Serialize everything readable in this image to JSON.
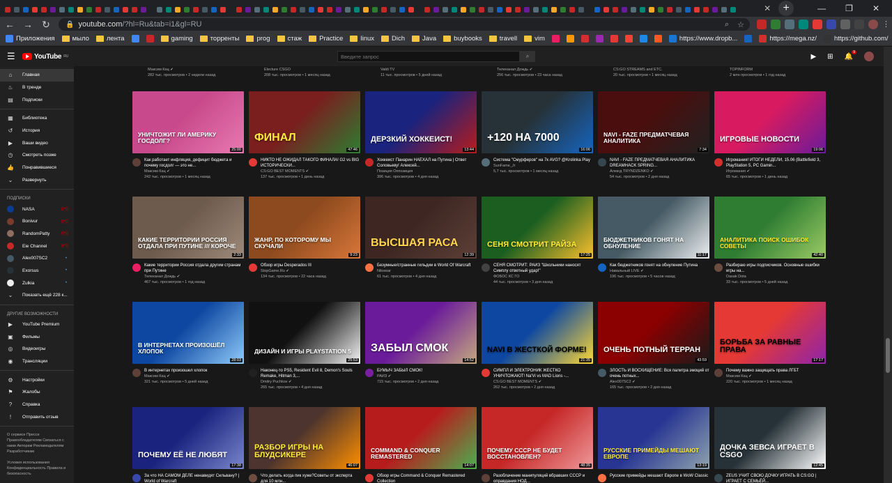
{
  "browser": {
    "url_host": "youtube.com",
    "url_path": "/?hl=Ru&tab=i1&gl=RU",
    "bookmarks": [
      {
        "label": "Приложения",
        "kind": "apps"
      },
      {
        "label": "мыло",
        "kind": "folder"
      },
      {
        "label": "лента",
        "kind": "folder"
      },
      {
        "label": "",
        "kind": "icon",
        "color": "#4285f4"
      },
      {
        "label": "",
        "kind": "icon",
        "color": "#c62828"
      },
      {
        "label": "gaming",
        "kind": "folder"
      },
      {
        "label": "торренты",
        "kind": "folder"
      },
      {
        "label": "prog",
        "kind": "folder"
      },
      {
        "label": "стаж",
        "kind": "folder"
      },
      {
        "label": "Practice",
        "kind": "folder"
      },
      {
        "label": "linux",
        "kind": "folder"
      },
      {
        "label": "Dich",
        "kind": "folder"
      },
      {
        "label": "Java",
        "kind": "folder"
      },
      {
        "label": "buybooks",
        "kind": "folder"
      },
      {
        "label": "travell",
        "kind": "folder"
      },
      {
        "label": "vim",
        "kind": "folder"
      },
      {
        "label": "",
        "kind": "icon",
        "color": "#e91e63"
      },
      {
        "label": "",
        "kind": "icon",
        "color": "#ff9800"
      },
      {
        "label": "",
        "kind": "icon",
        "color": "#d32f2f"
      },
      {
        "label": "",
        "kind": "icon",
        "color": "#9c27b0"
      },
      {
        "label": "",
        "kind": "icon",
        "color": "#e53935"
      },
      {
        "label": "",
        "kind": "icon",
        "color": "#f44336"
      },
      {
        "label": "",
        "kind": "icon",
        "color": "#1e88e5"
      },
      {
        "label": "",
        "kind": "icon",
        "color": "#ff5722"
      },
      {
        "label": "https://www.dropb...",
        "kind": "icon",
        "color": "#1976d2"
      },
      {
        "label": "",
        "kind": "icon",
        "color": "#1565c0"
      },
      {
        "label": "https://mega.nz/",
        "kind": "icon",
        "color": "#d32f2f"
      },
      {
        "label": "https://github.com/",
        "kind": "icon",
        "color": "#333333"
      }
    ]
  },
  "yt": {
    "logo_text": "YouTube",
    "logo_region": "RU",
    "search_placeholder": "Введите запрос",
    "notif_count": "9"
  },
  "sidebar": {
    "main": [
      {
        "label": "Главная",
        "icon": "home-icon",
        "glyph": "⌂",
        "active": true
      },
      {
        "label": "В тренде",
        "icon": "trending-icon",
        "glyph": "♨",
        "active": false
      },
      {
        "label": "Подписки",
        "icon": "subscriptions-icon",
        "glyph": "▤",
        "active": false
      }
    ],
    "library": [
      {
        "label": "Библиотека",
        "icon": "library-icon",
        "glyph": "▦"
      },
      {
        "label": "История",
        "icon": "history-icon",
        "glyph": "↺"
      },
      {
        "label": "Ваши видео",
        "icon": "your-videos-icon",
        "glyph": "▶"
      },
      {
        "label": "Смотреть позже",
        "icon": "watch-later-icon",
        "glyph": "◷"
      },
      {
        "label": "Понравившиеся",
        "icon": "liked-icon",
        "glyph": "👍"
      },
      {
        "label": "Развернуть",
        "icon": "chevron-down-icon",
        "glyph": "⌄"
      }
    ],
    "subs_heading": "ПОДПИСКИ",
    "subs": [
      {
        "label": "NASA",
        "color": "#0b3d91",
        "badge": "live"
      },
      {
        "label": "Bonivur",
        "color": "#7a3b2e",
        "badge": "live"
      },
      {
        "label": "RandomPatty",
        "color": "#8d6e63",
        "badge": "live"
      },
      {
        "label": "Eie Channel",
        "color": "#c62828",
        "badge": "live"
      },
      {
        "label": "Alex007SC2",
        "color": "#455a64",
        "badge": "dot"
      },
      {
        "label": "Exorsus",
        "color": "#263238",
        "badge": "dot"
      },
      {
        "label": "Zulkia",
        "color": "#eeeeee",
        "badge": "dot"
      }
    ],
    "show_more": "Показать ещё 228 к...",
    "more_heading": "ДРУГИЕ ВОЗМОЖНОСТИ",
    "more": [
      {
        "label": "YouTube Premium",
        "icon": "youtube-premium-icon",
        "glyph": "▶"
      },
      {
        "label": "Фильмы",
        "icon": "movies-icon",
        "glyph": "▣"
      },
      {
        "label": "Видеоигры",
        "icon": "gaming-icon",
        "glyph": "◎"
      },
      {
        "label": "Трансляции",
        "icon": "live-icon",
        "glyph": "◉"
      }
    ],
    "settings": [
      {
        "label": "Настройки",
        "icon": "gear-icon",
        "glyph": "⚙"
      },
      {
        "label": "Жалобы",
        "icon": "flag-icon",
        "glyph": "⚑"
      },
      {
        "label": "Справка",
        "icon": "help-icon",
        "glyph": "?"
      },
      {
        "label": "Отправить отзыв",
        "icon": "feedback-icon",
        "glyph": "!"
      }
    ],
    "footer1": "О сервисе  Прессе  Правообладателям  Связаться с нами  Авторам  Рекламодателям  Разработчикам",
    "footer2": "Условия использования  Конфиденциальность  Правила и безопасность"
  },
  "top_row": [
    {
      "channel": "Максим Кац ✔",
      "stats": "282 тыс. просмотров • 2 недели назад"
    },
    {
      "channel": "Electure CSGO",
      "stats": "208 тыс. просмотров • 1 месяц назад"
    },
    {
      "channel": "Valdi TV",
      "stats": "11 тыс. просмотров • 5 дней назад"
    },
    {
      "channel": "Телеканал Дождь ✔",
      "stats": "256 тыс. просмотров • 23 часа назад"
    },
    {
      "channel": "CS:GO STREAMS and ETC.",
      "stats": "20 тыс. просмотров • 1 месяц назад"
    },
    {
      "channel": "TOPINFORM",
      "stats": "2 млн просмотров • 1 год назад"
    }
  ],
  "videos": [
    {
      "title": "Как работает инфляция, дефицит бюджета и почему госдолг — это не...",
      "channel": "Максим Кац ✔",
      "stats": "242 тыс. просмотров • 1 месяц назад",
      "duration": "25:00",
      "bg": "#c84a8c",
      "bg2": "#e879b0",
      "text": "Уничтожит ли Америку госдолг?",
      "tcolor": "#ffffff",
      "avatar": "#5d4037"
    },
    {
      "title": "НИКТО НЕ ОЖИДАЛ ТАКОГО ФИНАЛА! G2 vs BIG ИСТОРИЧЕСКИ...",
      "channel": "CS:GO BEST MOMENTS ✔",
      "stats": "137 тыс. просмотров • 1 день назад",
      "duration": "47:46",
      "bg": "#7a1e1e",
      "bg2": "#2e7d32",
      "text": "ФИНАЛ",
      "tcolor": "#ffeb3b",
      "avatar": "#e53935"
    },
    {
      "title": "Хоккеист Панарин НАЕХАЛ на Путина | Ответ Соловьеву! Алексей...",
      "channel": "Позиция Оппозиция",
      "stats": "396 тыс. просмотров • 4 дня назад",
      "duration": "13:44",
      "bg": "#1a237e",
      "bg2": "#b71c1c",
      "text": "ДЕРЗКИЙ ХОККЕИСТ!",
      "tcolor": "#ffffff",
      "avatar": "#c62828"
    },
    {
      "title": "Система \"Смурферов\" на 7к AVG? @Krolinka Play",
      "channel": "SunFame_Jr",
      "stats": "5,7 тыс. просмотров • 1 месяц назад",
      "duration": "16:06",
      "bg": "#263238",
      "bg2": "#1565c0",
      "text": "+120 на 7000",
      "tcolor": "#ffffff",
      "avatar": "#546e7a"
    },
    {
      "title": "NAVI - FAZE ПРЕДМАТЧЕВАЯ АНАЛИТИКА DREAMHACK SPRING...",
      "channel": "Алекгд TRYNDZENKO ✔",
      "stats": "54 тыс. просмотров • 2 дня назад",
      "duration": "7:34",
      "bg": "#4a0e0e",
      "bg2": "#212121",
      "text": "NAVI - FAZE ПРЕДМАТЧЕВАЯ АНАЛИТИКА",
      "tcolor": "#ffffff",
      "avatar": "#37474f"
    },
    {
      "title": "Игромания! ИТОГИ НЕДЕЛИ, 15.06 (Battlefield 3, PlayStation 5, PC Gamin...",
      "channel": "Игромания ✔",
      "stats": "65 тыс. просмотров • 1 день назад",
      "duration": "19:06",
      "bg": "#d81b60",
      "bg2": "#6a1b9a",
      "text": "ИГРОВЫЕ НОВОСТИ",
      "tcolor": "#ffffff",
      "avatar": "#d32f2f"
    },
    {
      "title": "Какие территории Россия отдала другим странам при Путине",
      "channel": "Телеканал Дождь ✔",
      "stats": "467 тыс. просмотров • 1 год назад",
      "duration": "2:33",
      "bg": "#6d5b4d",
      "bg2": "#9e8a7a",
      "text": "КАКИЕ ТЕРРИТОРИИ РОССИЯ ОТДАЛА ПРИ ПУТИНЕ /// КОРОЧЕ",
      "tcolor": "#ffffff",
      "avatar": "#e91e63"
    },
    {
      "title": "Обзор игры Desperados III",
      "channel": "StopGame.Ru ✔",
      "stats": "134 тыс. просмотров • 22 часа назад",
      "duration": "9:23",
      "bg": "#8d4a1e",
      "bg2": "#d9773a",
      "text": "ЖАНР, ПО КОТОРОМУ МЫ СКУЧАЛИ",
      "tcolor": "#ffffff",
      "avatar": "#e53935"
    },
    {
      "title": "Безумные/странные гильдии в World Of Warcraft",
      "channel": "Nikowar",
      "stats": "61 тыс. просмотров • 4 дня назад",
      "duration": "12:39",
      "bg": "#3e2723",
      "bg2": "#5d4037",
      "text": "ВЫСШАЯ РАСА",
      "tcolor": "#ffd54f",
      "avatar": "#ff7043"
    },
    {
      "title": "СЕНЯ СМОТРИТ: РАЙЗ \"Школьники наносят Симплу ответный удар!\"",
      "channel": "ФОБОС КС ГО",
      "stats": "44 тыс. просмотров • 3 дня назад",
      "duration": "17:25",
      "bg": "#1b5e20",
      "bg2": "#fbc02d",
      "text": "СЕНЯ СМОТРИТ РАЙЗА",
      "tcolor": "#ffeb3b",
      "avatar": "#424242"
    },
    {
      "title": "Как бюджетников гонят на обнуление Путина",
      "channel": "Навальный LIVE ✔",
      "stats": "196 тыс. просмотров • 5 часов назад",
      "duration": "11:17",
      "bg": "#455a64",
      "bg2": "#eceff1",
      "text": "Бюджетников гонят на обнуление",
      "tcolor": "#ffffff",
      "avatar": "#1565c0"
    },
    {
      "title": "Разбираю игры подписчиков. Основные ошибки игры на...",
      "channel": "Dasak Dota",
      "stats": "33 тыс. просмотров • 5 дней назад",
      "duration": "42:40",
      "bg": "#2e7d32",
      "bg2": "#9ccc65",
      "text": "АНАЛИТИКА ПОИСК ОШИБОК СОВЕТЫ",
      "tcolor": "#ffeb3b",
      "avatar": "#6d4c41"
    },
    {
      "title": "В интернетах произошел хлопок",
      "channel": "Максим Кац ✔",
      "stats": "321 тыс. просмотров • 5 дней назад",
      "duration": "28:03",
      "bg": "#0d47a1",
      "bg2": "#90caf9",
      "text": "В интернетах произошёл хлопок",
      "tcolor": "#ffffff",
      "avatar": "#5d4037"
    },
    {
      "title": "Наконец-то PS5, Resident Evil 8, Demon's Souls Remake, Hitman 3,...",
      "channel": "Dmitry Puchkov ✔",
      "stats": "265 тыс. просмотров • 4 дня назад",
      "duration": "25:53",
      "bg": "#111111",
      "bg2": "#f5f5f5",
      "text": "ДИЗАЙН И ИГРЫ PLAYSTATION 5",
      "tcolor": "#ffffff",
      "avatar": "#212121"
    },
    {
      "title": "БУМЫЧ ЗАБЫЛ СМОК!",
      "channel": "PAИЗ ✔",
      "stats": "715 тыс. просмотров • 2 дня назад",
      "duration": "14:52",
      "bg": "#6a1b9a",
      "bg2": "#c5a880",
      "text": "ЗАБЫЛ СМОК",
      "tcolor": "#ffffff",
      "avatar": "#7b1fa2"
    },
    {
      "title": "СИМПЛ И ЭЛЕКТРОНИК ЖЕСТКО УНИЧТОЖАЮТ! Na'Vi vs MAD Lions -...",
      "channel": "CS:GO BEST MOMENTS ✔",
      "stats": "262 тыс. просмотров • 2 дня назад",
      "duration": "21:35",
      "bg": "#0d47a1",
      "bg2": "#fdd835",
      "text": "NAVI В ЖЕСТКОЙ ФОРМЕ!",
      "tcolor": "#000000",
      "avatar": "#e53935"
    },
    {
      "title": "ЗЛОСТЬ И ВОСХИЩЕНИЕ: Вся палитра эмоций от очень потных...",
      "channel": "Alex007SC2 ✔",
      "stats": "165 тыс. просмотров • 2 дня назад",
      "duration": "43:59",
      "bg": "#8b0000",
      "bg2": "#1a1a1a",
      "text": "ОЧЕНЬ ПОТНЫЙ ТЕРРАН",
      "tcolor": "#ffffff",
      "avatar": "#455a64"
    },
    {
      "title": "Почему важно защищать права ЛГБТ",
      "channel": "Максим Кац ✔",
      "stats": "220 тыс. просмотров • 1 месяц назад",
      "duration": "17:17",
      "bg": "#e53935",
      "bg2": "#8e24aa",
      "text": "Борьба за равные права",
      "tcolor": "#000000",
      "avatar": "#5d4037"
    },
    {
      "title": "За что НА САМОМ ДЕЛЕ ненавидят Сильвану? | World of Warcraft",
      "channel": "",
      "stats": "",
      "duration": "17:38",
      "bg": "#1a237e",
      "bg2": "#7986cb",
      "text": "ПОЧЕМУ ЕЁ НЕ ЛЮБЯТ",
      "tcolor": "#ffffff",
      "avatar": "#3949ab"
    },
    {
      "title": "Что делать когда пик хуже?Советы от эксперта для 10 млн...",
      "channel": "",
      "stats": "",
      "duration": "46:07",
      "bg": "#4e342e",
      "bg2": "#ff8f00",
      "text": "РАЗБОР ИГРЫ НА БЛУДСИКЕРЕ",
      "tcolor": "#ffeb3b",
      "avatar": "#6d4c41"
    },
    {
      "title": "Обзор игры Command & Conquer Remastered Collection",
      "channel": "",
      "stats": "",
      "duration": "14:07",
      "bg": "#b71c1c",
      "bg2": "#4caf50",
      "text": "COMMAND & CONQUER REMASTERED",
      "tcolor": "#ffffff",
      "avatar": "#e53935"
    },
    {
      "title": "Разоблачение манипуляций вбравших СССР и оправдания НОД...",
      "channel": "",
      "stats": "",
      "duration": "48:35",
      "bg": "#c62828",
      "bg2": "#ef9a9a",
      "text": "ПОЧЕМУ СССР не будет восстановлен?",
      "tcolor": "#ffffff",
      "avatar": "#5d4037"
    },
    {
      "title": "Русские примейды мешают Европе в WoW Classic",
      "channel": "",
      "stats": "",
      "duration": "13:19",
      "bg": "#283593",
      "bg2": "#90a4ae",
      "text": "РУССКИЕ ПРИМЕЙДЫ МЕШАЮТ ЕВРОПЕ",
      "tcolor": "#ffeb3b",
      "avatar": "#ff7043"
    },
    {
      "title": "ZEUS УЧИТ СВОЮ ДОЧКУ ИГРАТЬ В CS:GO | ИГРАЕТ С СЕМЬЁЙ...",
      "channel": "",
      "stats": "",
      "duration": "12:45",
      "bg": "#263238",
      "bg2": "#ffffff",
      "text": "ДОЧКА ЗЕВСА ИГРАЕТ В CSGO",
      "tcolor": "#ffffff",
      "avatar": "#37474f"
    }
  ]
}
